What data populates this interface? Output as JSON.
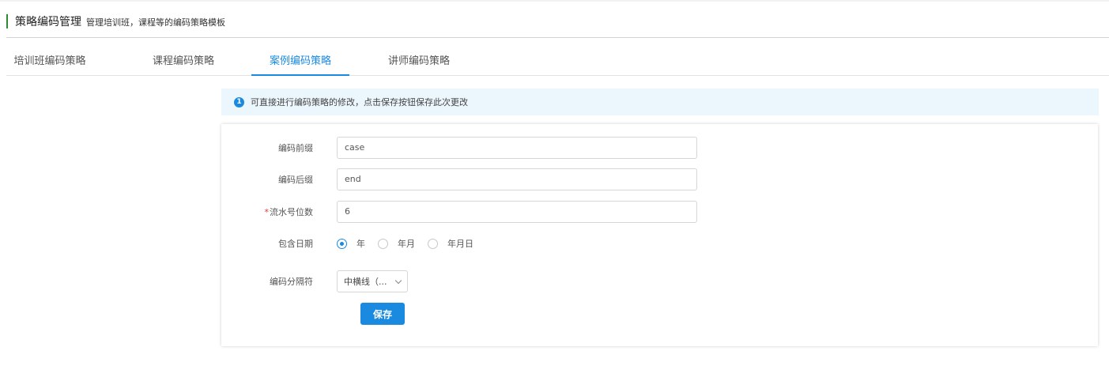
{
  "header": {
    "title": "策略编码管理",
    "subtitle": "管理培训班，课程等的编码策略模板"
  },
  "tabs": [
    {
      "label": "培训班编码策略",
      "active": false
    },
    {
      "label": "课程编码策略",
      "active": false
    },
    {
      "label": "案例编码策略",
      "active": true
    },
    {
      "label": "讲师编码策略",
      "active": false
    }
  ],
  "notice": {
    "icon_text": "1",
    "text": "可直接进行编码策略的修改，点击保存按钮保存此次更改"
  },
  "form": {
    "prefix": {
      "label": "编码前缀",
      "value": "case"
    },
    "suffix": {
      "label": "编码后缀",
      "value": "end"
    },
    "serial_digits": {
      "required_mark": "*",
      "label": "流水号位数",
      "value": "6"
    },
    "include_date": {
      "label": "包含日期",
      "options": [
        "年",
        "年月",
        "年月日"
      ],
      "selected": "年"
    },
    "separator": {
      "label": "编码分隔符",
      "value": "中横线（..."
    }
  },
  "save_label": "保存",
  "colors": {
    "accent": "#1a8ae0",
    "header_bar": "#2d8a2d",
    "notice_bg": "#ecf6fd"
  }
}
